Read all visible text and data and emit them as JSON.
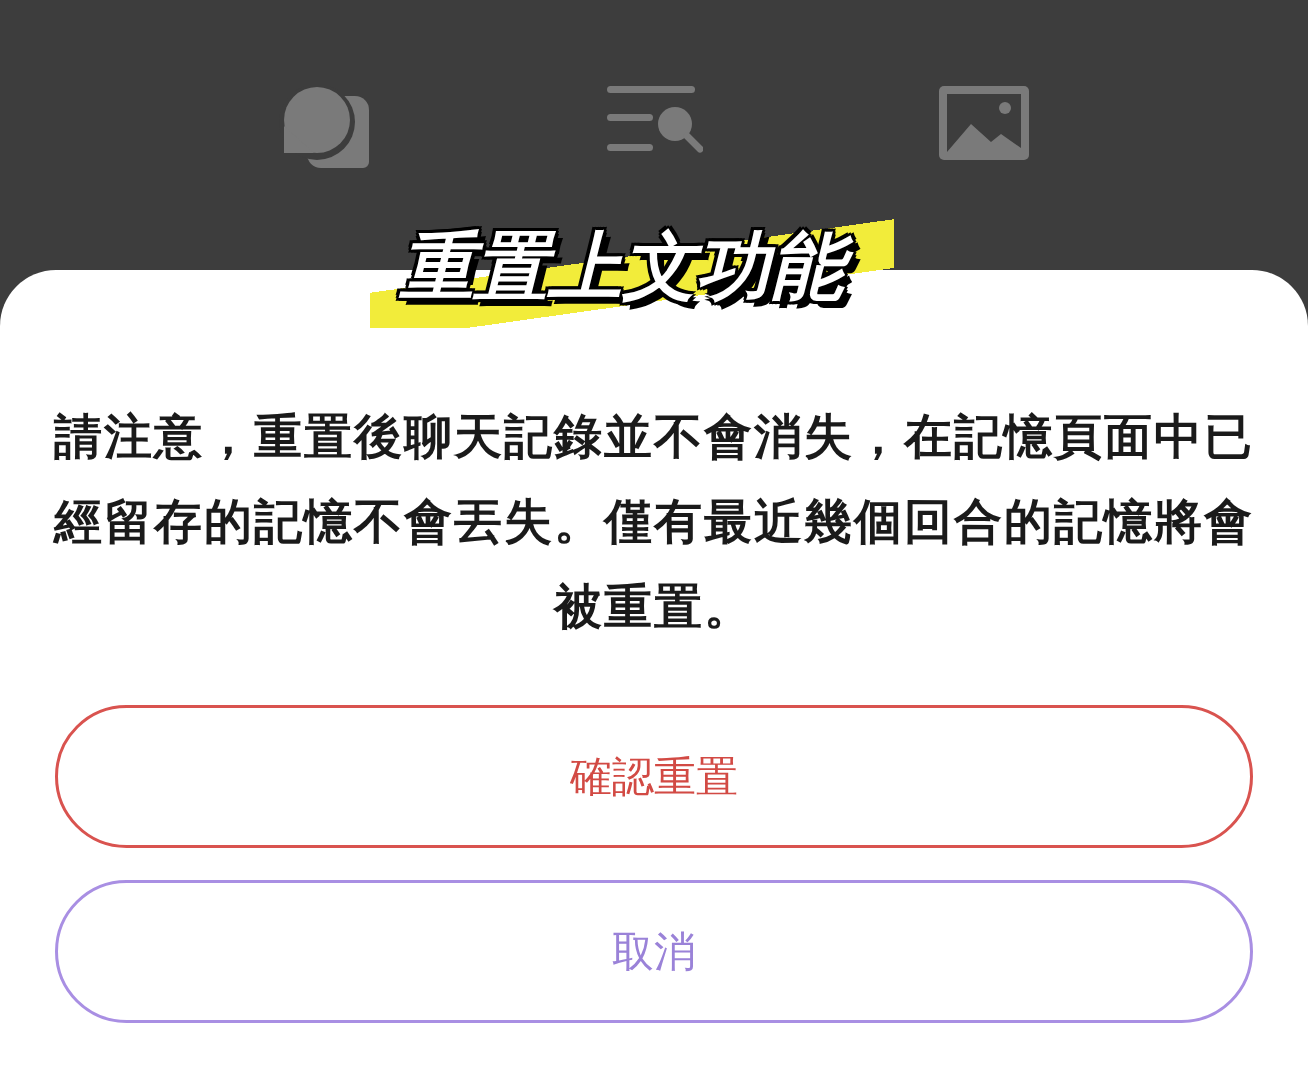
{
  "caption": "重置上文功能",
  "dialog": {
    "message": "請注意，重置後聊天記錄並不會消失，在記憶頁面中已經留存的記憶不會丟失。僅有最近幾個回合的記憶將會被重置。",
    "buttons": [
      {
        "label": "確認重置",
        "kind": "danger"
      },
      {
        "label": "取消",
        "kind": "cancel"
      }
    ]
  }
}
